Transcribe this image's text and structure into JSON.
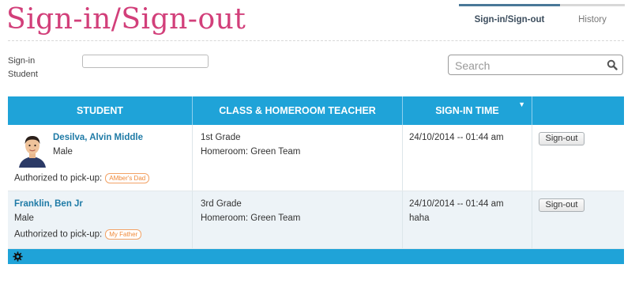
{
  "header": {
    "title": "Sign-in/Sign-out",
    "tabs": [
      {
        "label": "Sign-in/Sign-out",
        "active": true
      },
      {
        "label": "History",
        "active": false
      }
    ]
  },
  "signin": {
    "label": "Sign-in Student",
    "value": ""
  },
  "search": {
    "placeholder": "Search",
    "icon": "search-icon"
  },
  "table": {
    "columns": [
      "STUDENT",
      "CLASS & HOMEROOM TEACHER",
      "SIGN-IN TIME",
      ""
    ],
    "sort_icon": "▼",
    "rows": [
      {
        "name": "Desilva, Alvin Middle",
        "gender": "Male",
        "auth_label": "Authorized to pick-up:",
        "auth_person": "AMber's Dad",
        "class": "1st Grade",
        "homeroom": "Homeroom: Green Team",
        "time": "24/10/2014 -- 01:44 am",
        "note": "",
        "action": "Sign-out",
        "has_avatar": true
      },
      {
        "name": "Franklin, Ben Jr",
        "gender": "Male",
        "auth_label": "Authorized to pick-up:",
        "auth_person": "My Father",
        "class": "3rd Grade",
        "homeroom": "Homeroom: Green Team",
        "time": "24/10/2014 -- 01:44 am",
        "note": "haha",
        "action": "Sign-out",
        "has_avatar": false
      }
    ]
  },
  "footer": {
    "icon": "gear-icon"
  },
  "colors": {
    "title": "#d23f7a",
    "header_bg": "#1fa3d8",
    "link": "#1e7aa6",
    "badge": "#f08a3a"
  }
}
